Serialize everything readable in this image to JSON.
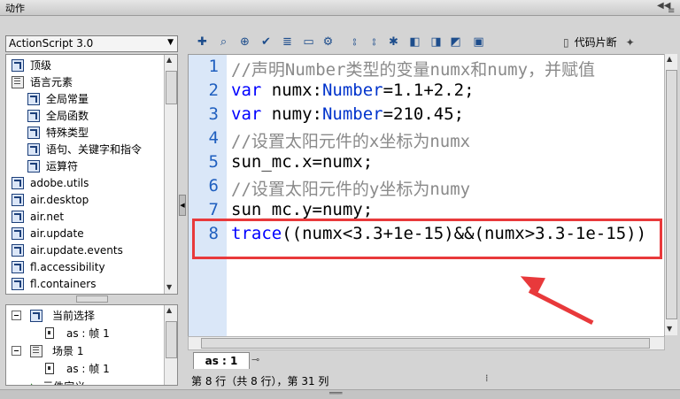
{
  "window": {
    "title": "动作"
  },
  "language_select": {
    "value": "ActionScript 3.0"
  },
  "library_tree": {
    "items": [
      {
        "label": "顶级",
        "icon": "book-icon",
        "indent": 0
      },
      {
        "label": "语言元素",
        "icon": "folder-icon",
        "indent": 0
      },
      {
        "label": "全局常量",
        "icon": "book-icon",
        "indent": 1
      },
      {
        "label": "全局函数",
        "icon": "book-icon",
        "indent": 1
      },
      {
        "label": "特殊类型",
        "icon": "book-icon",
        "indent": 1
      },
      {
        "label": "语句、关键字和指令",
        "icon": "book-icon",
        "indent": 1
      },
      {
        "label": "运算符",
        "icon": "book-icon",
        "indent": 1
      },
      {
        "label": "adobe.utils",
        "icon": "book-icon",
        "indent": 0
      },
      {
        "label": "air.desktop",
        "icon": "book-icon",
        "indent": 0
      },
      {
        "label": "air.net",
        "icon": "book-icon",
        "indent": 0
      },
      {
        "label": "air.update",
        "icon": "book-icon",
        "indent": 0
      },
      {
        "label": "air.update.events",
        "icon": "book-icon",
        "indent": 0
      },
      {
        "label": "fl.accessibility",
        "icon": "book-icon",
        "indent": 0
      },
      {
        "label": "fl.containers",
        "icon": "book-icon",
        "indent": 0
      }
    ]
  },
  "script_nav": {
    "items": [
      {
        "label": "当前选择",
        "kind": "selection"
      },
      {
        "label": "as : 帧 1",
        "kind": "frame"
      },
      {
        "label": "场景 1",
        "kind": "scene"
      },
      {
        "label": "as : 帧 1",
        "kind": "frame"
      },
      {
        "label": "元件定义",
        "kind": "symbol"
      }
    ]
  },
  "toolbar": {
    "icons": [
      "add-item-icon",
      "find-icon",
      "target-icon",
      "check-syntax-icon",
      "auto-format-icon",
      "code-hint-icon",
      "debug-icon",
      "collapse-icon",
      "collapse-selection-icon",
      "expand-icon",
      "apply-comment-icon",
      "line-comment-icon",
      "remove-comment-icon",
      "script-assist-icon"
    ],
    "snippets_label": "代码片断",
    "wizard_icon": "magic-wand-icon"
  },
  "editor": {
    "lines": [
      {
        "num": "1",
        "text": "//声明Number类型的变量numx和numy，并赋值"
      },
      {
        "num": "2",
        "text": "var numx:Number=1.1+2.2;"
      },
      {
        "num": "3",
        "text": "var numy:Number=210.45;"
      },
      {
        "num": "4",
        "text": "//设置太阳元件的x坐标为numx"
      },
      {
        "num": "5",
        "text": "sun_mc.x=numx;"
      },
      {
        "num": "6",
        "text": "//设置太阳元件的y坐标为numy"
      },
      {
        "num": "7",
        "text": "sun_mc.y=numy;"
      },
      {
        "num": "8",
        "text": "trace((numx<3.3+1e-15)&&(numx>3.3-1e-15))"
      }
    ],
    "highlight_color": "#e8393b"
  },
  "tab": {
    "label": "as : 1"
  },
  "status": {
    "text": "第 8 行（共 8 行），第 31 列"
  },
  "colors": {
    "keyword": "#0000ff",
    "comment": "#8a8a8a",
    "gutter": "#dae7f8",
    "line_number": "#1f5fbf"
  }
}
